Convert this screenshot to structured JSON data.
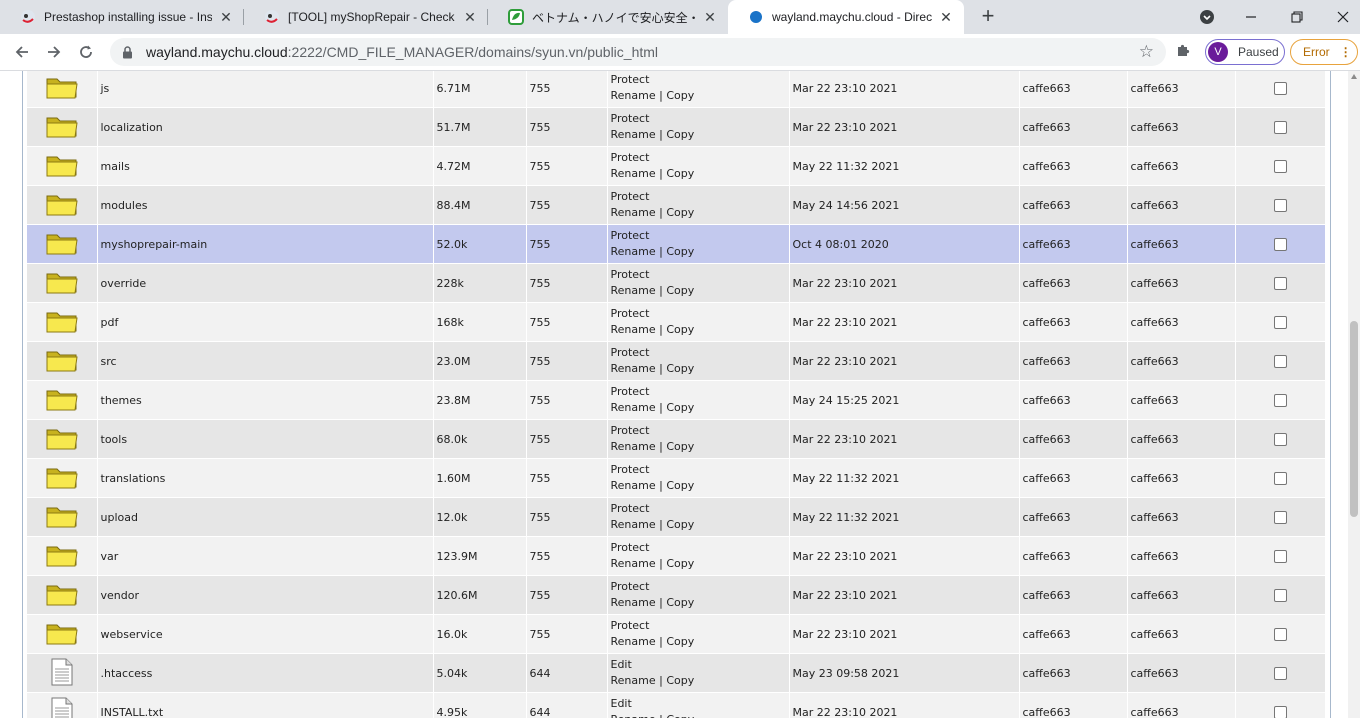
{
  "tabs": [
    {
      "title": "Prestashop installing issue - Insta",
      "favicon": "prestashop-favicon",
      "active": false
    },
    {
      "title": "[TOOL] myShopRepair - Check Pr",
      "favicon": "prestashop-favicon",
      "active": false
    },
    {
      "title": "ベトナム・ハノイで安心安全・旬の野菜",
      "favicon": "green-leaf-favicon",
      "active": false
    },
    {
      "title": "wayland.maychu.cloud - DirectAd",
      "favicon": "directadmin-favicon",
      "active": true
    }
  ],
  "toolbar": {
    "url_host": "wayland.maychu.cloud",
    "url_rest": ":2222/CMD_FILE_MANAGER/domains/syun.vn/public_html",
    "profile_initial": "V",
    "profile_label": "Paused",
    "error_label": "Error"
  },
  "actions": {
    "protect": "Protect",
    "edit": "Edit",
    "rename": "Rename",
    "copy": "Copy",
    "sep": "|"
  },
  "files": [
    {
      "name": "js",
      "size": "6.71M",
      "perm": "755",
      "date": "Mar 22 23:10 2021",
      "owner": "caffe663",
      "group": "caffe663",
      "type": "folder"
    },
    {
      "name": "localization",
      "size": "51.7M",
      "perm": "755",
      "date": "Mar 22 23:10 2021",
      "owner": "caffe663",
      "group": "caffe663",
      "type": "folder"
    },
    {
      "name": "mails",
      "size": "4.72M",
      "perm": "755",
      "date": "May 22 11:32 2021",
      "owner": "caffe663",
      "group": "caffe663",
      "type": "folder"
    },
    {
      "name": "modules",
      "size": "88.4M",
      "perm": "755",
      "date": "May 24 14:56 2021",
      "owner": "caffe663",
      "group": "caffe663",
      "type": "folder"
    },
    {
      "name": "myshoprepair-main",
      "size": "52.0k",
      "perm": "755",
      "date": "Oct 4 08:01 2020",
      "owner": "caffe663",
      "group": "caffe663",
      "type": "folder"
    },
    {
      "name": "override",
      "size": "228k",
      "perm": "755",
      "date": "Mar 22 23:10 2021",
      "owner": "caffe663",
      "group": "caffe663",
      "type": "folder"
    },
    {
      "name": "pdf",
      "size": "168k",
      "perm": "755",
      "date": "Mar 22 23:10 2021",
      "owner": "caffe663",
      "group": "caffe663",
      "type": "folder"
    },
    {
      "name": "src",
      "size": "23.0M",
      "perm": "755",
      "date": "Mar 22 23:10 2021",
      "owner": "caffe663",
      "group": "caffe663",
      "type": "folder"
    },
    {
      "name": "themes",
      "size": "23.8M",
      "perm": "755",
      "date": "May 24 15:25 2021",
      "owner": "caffe663",
      "group": "caffe663",
      "type": "folder"
    },
    {
      "name": "tools",
      "size": "68.0k",
      "perm": "755",
      "date": "Mar 22 23:10 2021",
      "owner": "caffe663",
      "group": "caffe663",
      "type": "folder"
    },
    {
      "name": "translations",
      "size": "1.60M",
      "perm": "755",
      "date": "May 22 11:32 2021",
      "owner": "caffe663",
      "group": "caffe663",
      "type": "folder"
    },
    {
      "name": "upload",
      "size": "12.0k",
      "perm": "755",
      "date": "May 22 11:32 2021",
      "owner": "caffe663",
      "group": "caffe663",
      "type": "folder"
    },
    {
      "name": "var",
      "size": "123.9M",
      "perm": "755",
      "date": "Mar 22 23:10 2021",
      "owner": "caffe663",
      "group": "caffe663",
      "type": "folder"
    },
    {
      "name": "vendor",
      "size": "120.6M",
      "perm": "755",
      "date": "Mar 22 23:10 2021",
      "owner": "caffe663",
      "group": "caffe663",
      "type": "folder"
    },
    {
      "name": "webservice",
      "size": "16.0k",
      "perm": "755",
      "date": "Mar 22 23:10 2021",
      "owner": "caffe663",
      "group": "caffe663",
      "type": "folder"
    },
    {
      "name": ".htaccess",
      "size": "5.04k",
      "perm": "644",
      "date": "May 23 09:58 2021",
      "owner": "caffe663",
      "group": "caffe663",
      "type": "file"
    },
    {
      "name": "INSTALL.txt",
      "size": "4.95k",
      "perm": "644",
      "date": "Mar 22 23:10 2021",
      "owner": "caffe663",
      "group": "caffe663",
      "type": "file"
    }
  ],
  "highlighted_row": "myshoprepair-main",
  "colors": {
    "row_even": "#f2f2f2",
    "row_odd": "#e6e6e6",
    "row_highlight": "#c3c9ee",
    "folder": "#f2e24a",
    "frame_border": "#a7b8cc"
  }
}
